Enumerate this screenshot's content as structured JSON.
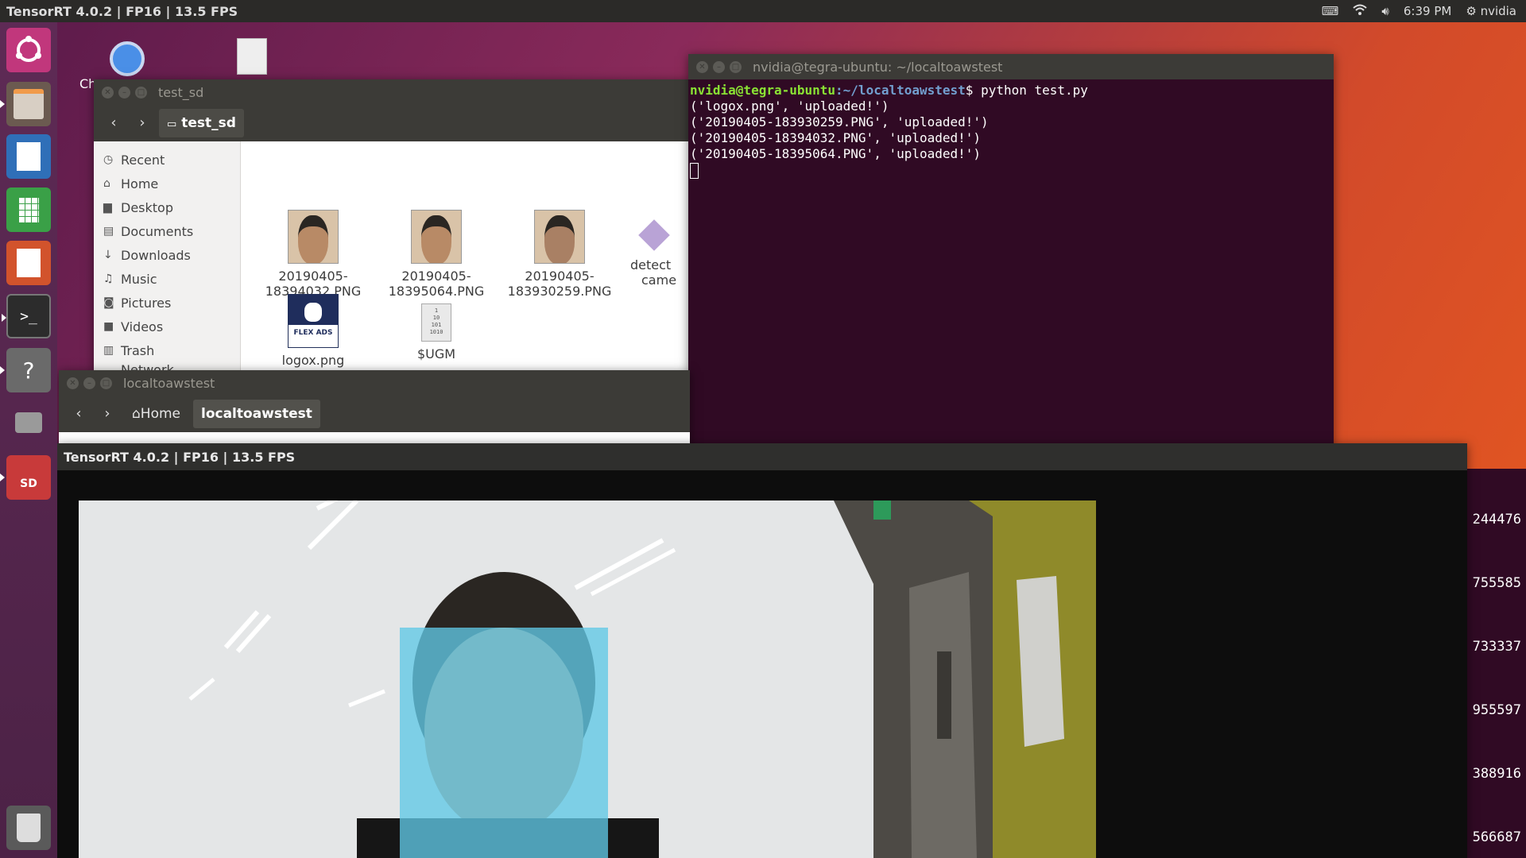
{
  "top_panel": {
    "title": "TensorRT 4.0.2 | FP16 | 13.5 FPS",
    "clock": "6:39 PM",
    "user": "nvidia",
    "icons": [
      "keyboard-icon",
      "wifi-icon",
      "volume-icon",
      "gear-icon"
    ]
  },
  "launcher": {
    "items": [
      "ubuntu-logo-icon",
      "files-icon",
      "writer-icon",
      "calc-icon",
      "impress-icon",
      "terminal-icon",
      "help-icon",
      "camera-icon",
      "sd-card-icon",
      "trash-icon"
    ],
    "sd_label": "SD"
  },
  "desktop": {
    "chromium_label_partial": "Ch"
  },
  "files_window": {
    "title": "test_sd",
    "breadcrumb": "test_sd",
    "sidebar": [
      "Recent",
      "Home",
      "Desktop",
      "Documents",
      "Downloads",
      "Music",
      "Pictures",
      "Videos",
      "Trash",
      "Network"
    ],
    "files": [
      {
        "line1": "20190405-",
        "line2": "18394032.PNG",
        "type": "face"
      },
      {
        "line1": "20190405-",
        "line2": "18395064.PNG",
        "type": "face"
      },
      {
        "line1": "20190405-",
        "line2": "183930259.PNG",
        "type": "face"
      },
      {
        "line1": "detect",
        "line2": "came",
        "type": "script"
      },
      {
        "line1": "logox.png",
        "line2": "",
        "type": "logo"
      },
      {
        "line1": "$UGM",
        "line2": "",
        "type": "binary"
      }
    ],
    "logo_text": "FLEX ADS",
    "binary_text": [
      "1",
      "10",
      "101",
      "1010"
    ]
  },
  "terminal": {
    "title": "nvidia@tegra-ubuntu: ~/localtoawstest",
    "prompt_user": "nvidia@tegra-ubuntu",
    "prompt_path": ":~/localtoawstest",
    "command": "$ python test.py",
    "lines": [
      "('logox.png', 'uploaded!')",
      "('20190405-183930259.PNG', 'uploaded!')",
      "('20190405-18394032.PNG', 'uploaded!')",
      "('20190405-18395064.PNG', 'uploaded!')"
    ]
  },
  "local_window": {
    "title": "localtoawstest",
    "crumb_home": "Home",
    "crumb_current": "localtoawstest"
  },
  "trt_window": {
    "title": "TensorRT 4.0.2 | FP16 | 13.5 FPS",
    "detection_color": "#60c8e6"
  },
  "side_numbers": [
    "244476",
    "755585",
    "733337",
    "955597",
    "388916",
    "566687"
  ]
}
